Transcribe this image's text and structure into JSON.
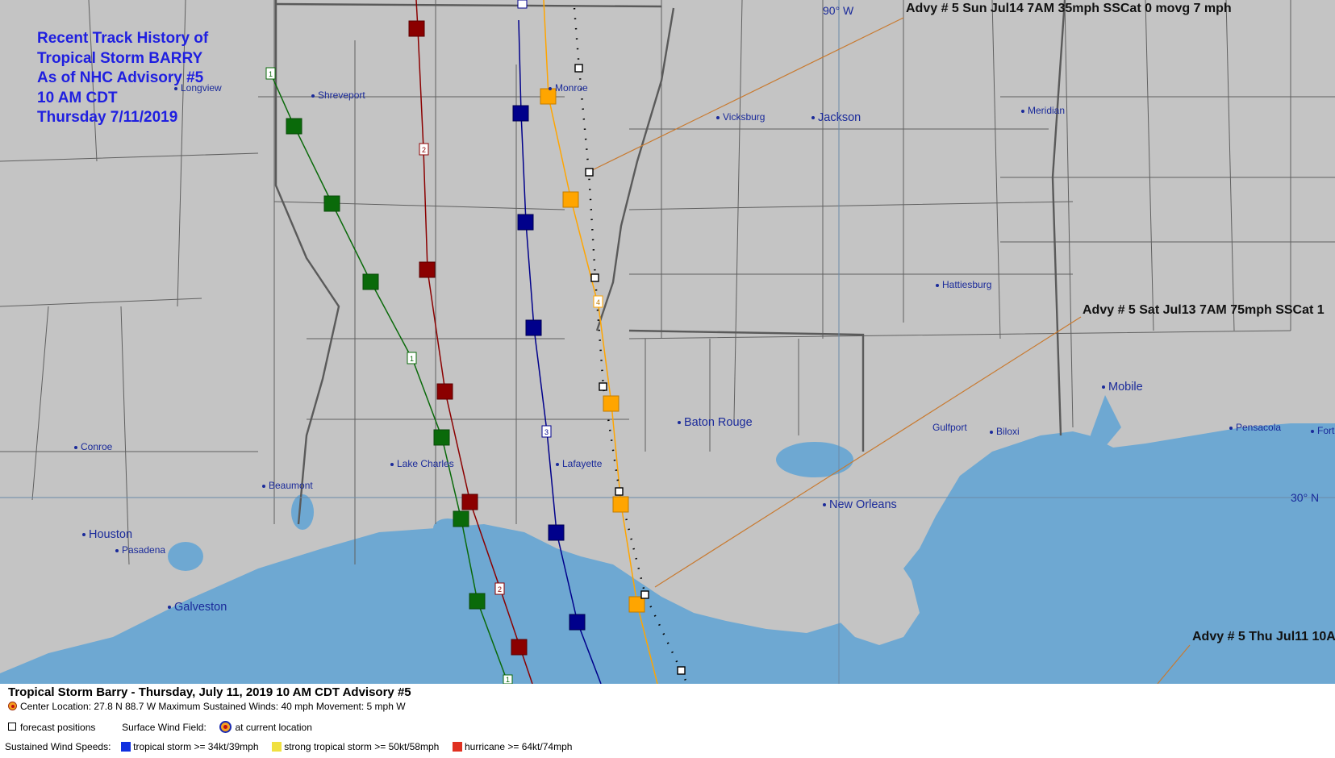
{
  "title": {
    "line1": "Recent Track History of",
    "line2": "Tropical Storm BARRY",
    "line3": "As of NHC Advisory #5",
    "line4": "10 AM CDT",
    "line5": "Thursday 7/11/2019"
  },
  "advisory_labels": {
    "sun": "Advy # 5 Sun Jul14 7AM  35mph SSCat 0 movg 7 mph",
    "sat": "Advy # 5 Sat Jul13 7AM  75mph SSCat 1",
    "thu": "Advy # 5 Thu Jul11 10A"
  },
  "grid_labels": {
    "lon": "90° W",
    "lat": "30° N"
  },
  "cities": [
    {
      "name": "Longview"
    },
    {
      "name": "Shreveport"
    },
    {
      "name": "Monroe"
    },
    {
      "name": "Vicksburg"
    },
    {
      "name": "Jackson"
    },
    {
      "name": "Meridian"
    },
    {
      "name": "Hattiesburg"
    },
    {
      "name": "Mobile"
    },
    {
      "name": "Gulfport"
    },
    {
      "name": "Biloxi"
    },
    {
      "name": "Pensacola"
    },
    {
      "name": "Fort"
    },
    {
      "name": "Baton Rouge"
    },
    {
      "name": "Lafayette"
    },
    {
      "name": "Lake Charles"
    },
    {
      "name": "Beaumont"
    },
    {
      "name": "Conroe"
    },
    {
      "name": "Houston"
    },
    {
      "name": "Pasadena"
    },
    {
      "name": "Galveston"
    },
    {
      "name": "New Orleans"
    }
  ],
  "track_markers": {
    "track1": "1",
    "track2": "2",
    "track3": "3",
    "track4": "4"
  },
  "legend": {
    "headline": "Tropical Storm Barry  -  Thursday, July 11, 2019  10 AM CDT   Advisory #5",
    "details": "Center Location: 27.8 N  88.7 W   Maximum Sustained Winds: 40 mph  Movement: 5 mph W",
    "forecast_label": "forecast positions",
    "wind_field_label": "Surface Wind Field:",
    "current_location_label": "at current location",
    "speeds_label": "Sustained Wind Speeds:",
    "ts_label": "tropical storm >= 34kt/39mph",
    "sts_label": "strong tropical storm >= 50kt/58mph",
    "hurricane_label": "hurricane >= 64kt/74mph"
  },
  "colors": {
    "land": "#c4c4c4",
    "water": "#6ea8d2",
    "tropical_storm": "#1030e0",
    "strong_tropical_storm": "#f0e040",
    "hurricane": "#e03020",
    "title": "#1f1fe0",
    "track_green": "#0a6a0a",
    "track_red": "#8b0000",
    "track_blue": "#00008b",
    "track_orange": "#ffa500"
  }
}
